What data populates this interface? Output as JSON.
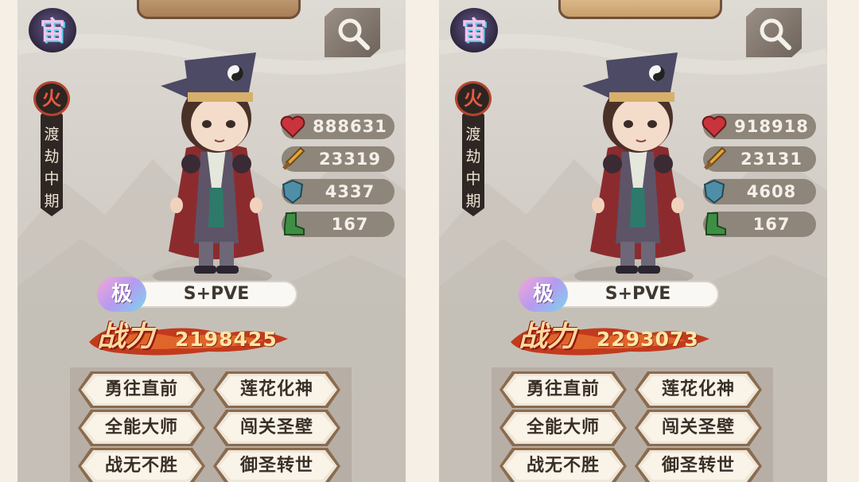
{
  "cards": [
    {
      "rank_glyph": "宙",
      "element": "火",
      "realm": [
        "渡",
        "劫",
        "中",
        "期"
      ],
      "stats": {
        "hp": "888631",
        "attack": "23319",
        "defense": "4337",
        "speed": "167"
      },
      "grade_icon": "极",
      "grade": "S+PVE",
      "power_label": "战力",
      "power": "2198425",
      "skills": [
        "勇往直前",
        "莲花化神",
        "全能大师",
        "闯关圣壁",
        "战无不胜",
        "御圣转世"
      ]
    },
    {
      "rank_glyph": "宙",
      "element": "火",
      "realm": [
        "渡",
        "劫",
        "中",
        "期"
      ],
      "stats": {
        "hp": "918918",
        "attack": "23131",
        "defense": "4608",
        "speed": "167"
      },
      "grade_icon": "极",
      "grade": "S+PVE",
      "power_label": "战力",
      "power": "2293073",
      "skills": [
        "勇往直前",
        "莲花化神",
        "全能大师",
        "闯关圣壁",
        "战无不胜",
        "御圣转世"
      ]
    }
  ],
  "icons": {
    "search": "magnifier-icon",
    "hp": "heart-icon",
    "attack": "sword-icon",
    "defense": "shield-icon",
    "speed": "boot-icon"
  },
  "colors": {
    "panel_bg": "#d8d3cc",
    "power_text": "#ffe7a8",
    "element_red": "#e55a43"
  }
}
